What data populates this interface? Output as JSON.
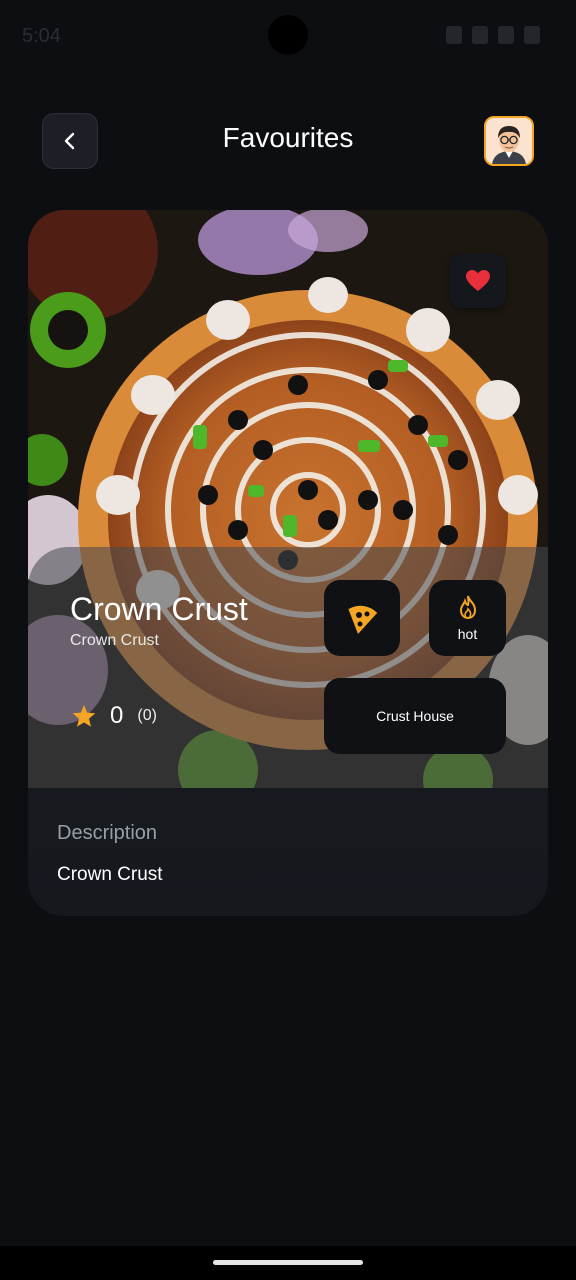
{
  "status_bar": {
    "time": "5:04"
  },
  "header": {
    "title": "Favourites",
    "back_icon": "chevron-left-icon",
    "avatar_icon": "avatar"
  },
  "item": {
    "name": "Crown Crust",
    "subtitle": "Crown Crust",
    "rating": "0",
    "rating_count": "(0)",
    "spice_label": "hot",
    "shop_name": "Crust House",
    "favourite_icon": "heart-icon",
    "category_icon": "pizza-icon",
    "spice_icon": "flame-icon"
  },
  "description": {
    "label": "Description",
    "text": "Crown Crust"
  },
  "colors": {
    "accent": "#f5a524",
    "heart": "#e8303a",
    "background": "#0c0e12"
  }
}
